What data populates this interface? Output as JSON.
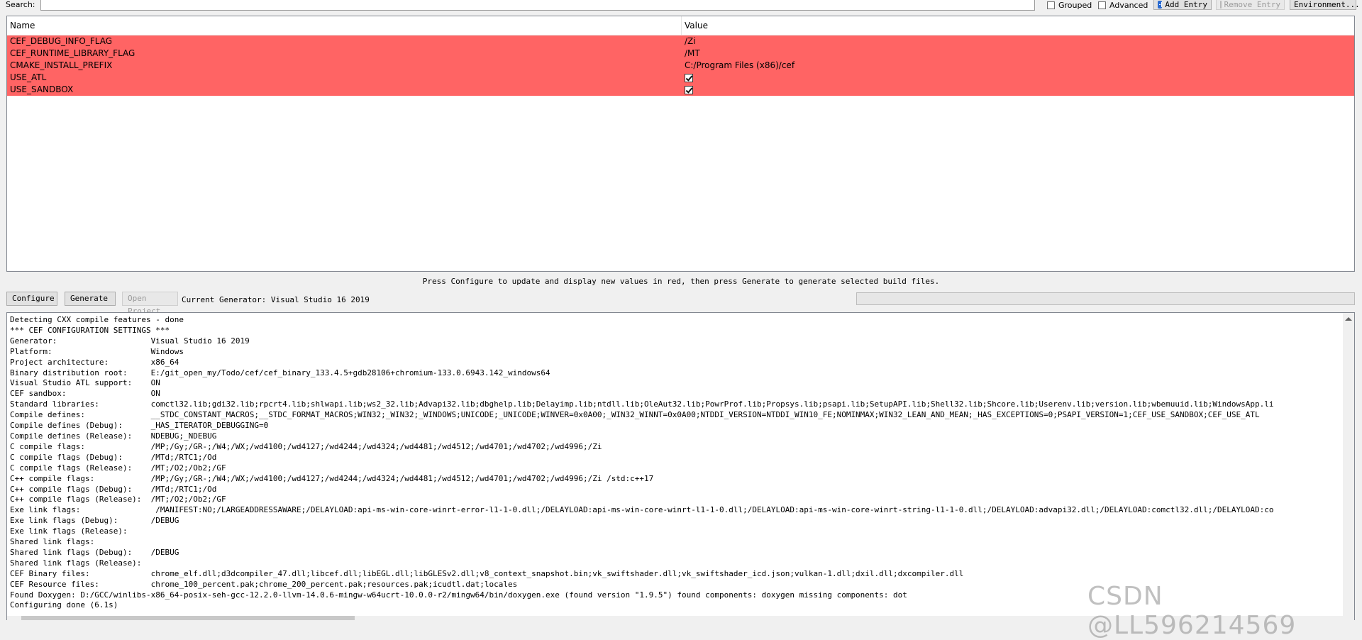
{
  "toolbar": {
    "search_label": "Search:",
    "search_value": "",
    "grouped_label": "Grouped",
    "advanced_label": "Advanced",
    "add_entry_label": "Add Entry",
    "remove_entry_label": "Remove Entry",
    "environment_label": "Environment..."
  },
  "table": {
    "col_name": "Name",
    "col_value": "Value",
    "row_color": "#ff6464",
    "rows": [
      {
        "name": "CEF_DEBUG_INFO_FLAG",
        "value": "/Zi"
      },
      {
        "name": "CEF_RUNTIME_LIBRARY_FLAG",
        "value": "/MT"
      },
      {
        "name": "CMAKE_INSTALL_PREFIX",
        "value": "C:/Program Files (x86)/cef"
      },
      {
        "name": "USE_ATL",
        "value": "checked"
      },
      {
        "name": "USE_SANDBOX",
        "value": "checked"
      }
    ]
  },
  "hint": "Press Configure to update and display new values in red, then press Generate to generate selected build files.",
  "actions": {
    "configure_label": "Configure",
    "generate_label": "Generate",
    "open_project_label": "Open Project",
    "generator_text": "Current Generator: Visual Studio 16 2019"
  },
  "log": [
    "Detecting CXX compile features - done",
    "*** CEF CONFIGURATION SETTINGS ***",
    "Generator:                    Visual Studio 16 2019",
    "Platform:                     Windows",
    "Project architecture:         x86_64",
    "Binary distribution root:     E:/git_open_my/Todo/cef/cef_binary_133.4.5+gdb28106+chromium-133.0.6943.142_windows64",
    "Visual Studio ATL support:    ON",
    "CEF sandbox:                  ON",
    "Standard libraries:           comctl32.lib;gdi32.lib;rpcrt4.lib;shlwapi.lib;ws2_32.lib;Advapi32.lib;dbghelp.lib;Delayimp.lib;ntdll.lib;OleAut32.lib;PowrProf.lib;Propsys.lib;psapi.lib;SetupAPI.lib;Shell32.lib;Shcore.lib;Userenv.lib;version.lib;wbemuuid.lib;WindowsApp.li",
    "Compile defines:              __STDC_CONSTANT_MACROS;__STDC_FORMAT_MACROS;WIN32;_WIN32;_WINDOWS;UNICODE;_UNICODE;WINVER=0x0A00;_WIN32_WINNT=0x0A00;NTDDI_VERSION=NTDDI_WIN10_FE;NOMINMAX;WIN32_LEAN_AND_MEAN;_HAS_EXCEPTIONS=0;PSAPI_VERSION=1;CEF_USE_SANDBOX;CEF_USE_ATL",
    "Compile defines (Debug):      _HAS_ITERATOR_DEBUGGING=0",
    "Compile defines (Release):    NDEBUG;_NDEBUG",
    "C compile flags:              /MP;/Gy;/GR-;/W4;/WX;/wd4100;/wd4127;/wd4244;/wd4324;/wd4481;/wd4512;/wd4701;/wd4702;/wd4996;/Zi",
    "C compile flags (Debug):      /MTd;/RTC1;/Od",
    "C compile flags (Release):    /MT;/O2;/Ob2;/GF",
    "C++ compile flags:            /MP;/Gy;/GR-;/W4;/WX;/wd4100;/wd4127;/wd4244;/wd4324;/wd4481;/wd4512;/wd4701;/wd4702;/wd4996;/Zi /std:c++17",
    "C++ compile flags (Debug):    /MTd;/RTC1;/Od",
    "C++ compile flags (Release):  /MT;/O2;/Ob2;/GF",
    "Exe link flags:                /MANIFEST:NO;/LARGEADDRESSAWARE;/DELAYLOAD:api-ms-win-core-winrt-error-l1-1-0.dll;/DELAYLOAD:api-ms-win-core-winrt-l1-1-0.dll;/DELAYLOAD:api-ms-win-core-winrt-string-l1-1-0.dll;/DELAYLOAD:advapi32.dll;/DELAYLOAD:comctl32.dll;/DELAYLOAD:co",
    "Exe link flags (Debug):       /DEBUG",
    "Exe link flags (Release):",
    "Shared link flags:",
    "Shared link flags (Debug):    /DEBUG",
    "Shared link flags (Release):",
    "CEF Binary files:             chrome_elf.dll;d3dcompiler_47.dll;libcef.dll;libEGL.dll;libGLESv2.dll;v8_context_snapshot.bin;vk_swiftshader.dll;vk_swiftshader_icd.json;vulkan-1.dll;dxil.dll;dxcompiler.dll",
    "CEF Resource files:           chrome_100_percent.pak;chrome_200_percent.pak;resources.pak;icudtl.dat;locales",
    "Found Doxygen: D:/GCC/winlibs-x86_64-posix-seh-gcc-12.2.0-llvm-14.0.6-mingw-w64ucrt-10.0.0-r2/mingw64/bin/doxygen.exe (found version \"1.9.5\") found components: doxygen missing components: dot",
    "Configuring done (6.1s)"
  ],
  "watermark": "CSDN @LL596214569"
}
